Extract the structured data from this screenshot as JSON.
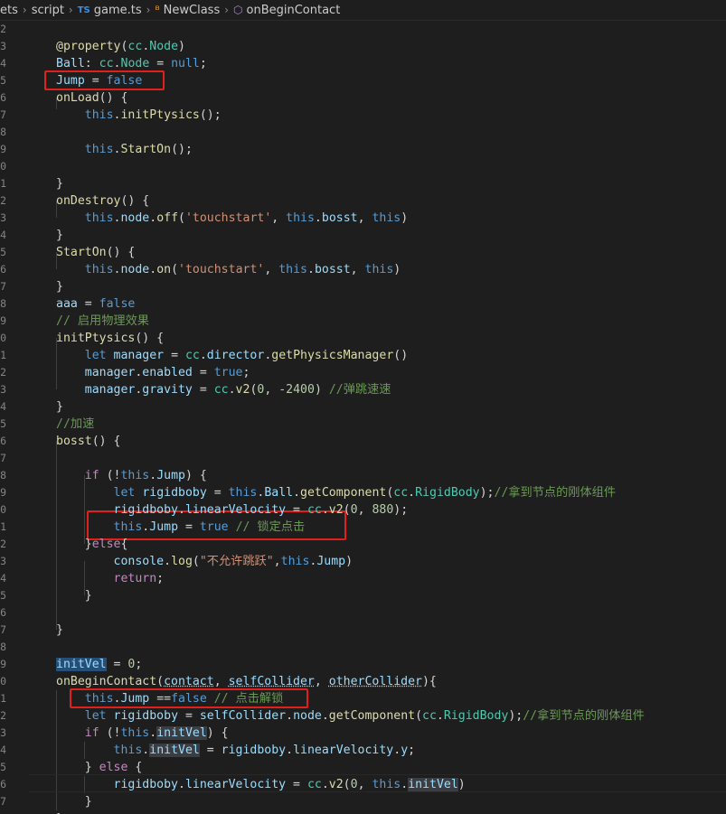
{
  "breadcrumb": {
    "seg0": "ets",
    "seg1": "script",
    "file_badge": "TS",
    "file": "game.ts",
    "class": "NewClass",
    "method": "onBeginContact"
  },
  "line_numbers": [
    "2",
    "3",
    "4",
    "5",
    "6",
    "7",
    "8",
    "9",
    "0",
    "1",
    "2",
    "3",
    "4",
    "5",
    "6",
    "7",
    "8",
    "9",
    "0",
    "1",
    "2",
    "3",
    "4",
    "5",
    "6",
    "7",
    "8",
    "9",
    "0",
    "1",
    "2",
    "3",
    "4",
    "5",
    "6",
    "7",
    "8",
    "9",
    "0",
    "1",
    "2",
    "3",
    "4",
    "5",
    "6",
    "7",
    "8"
  ],
  "code_lines": [
    [],
    [
      [
        "fn",
        "@property"
      ],
      [
        "d",
        "("
      ],
      [
        "cls",
        "cc"
      ],
      [
        "d",
        "."
      ],
      [
        "cls",
        "Node"
      ],
      [
        "d",
        ")"
      ]
    ],
    [
      [
        "prop",
        "Ball"
      ],
      [
        "d",
        ": "
      ],
      [
        "cls",
        "cc"
      ],
      [
        "d",
        "."
      ],
      [
        "cls",
        "Node"
      ],
      [
        "d",
        " = "
      ],
      [
        "kw",
        "null"
      ],
      [
        "d",
        ";"
      ]
    ],
    [
      [
        "prop",
        "Jump"
      ],
      [
        "d",
        " = "
      ],
      [
        "kw",
        "false"
      ]
    ],
    [
      [
        "fn",
        "onLoad"
      ],
      [
        "d",
        "() {"
      ]
    ],
    [
      [
        "d",
        "    "
      ],
      [
        "kw",
        "this"
      ],
      [
        "d",
        "."
      ],
      [
        "fn",
        "initPtysics"
      ],
      [
        "d",
        "();"
      ]
    ],
    [],
    [
      [
        "d",
        "    "
      ],
      [
        "kw",
        "this"
      ],
      [
        "d",
        "."
      ],
      [
        "fn",
        "StartOn"
      ],
      [
        "d",
        "();"
      ]
    ],
    [],
    [
      [
        "d",
        "}"
      ]
    ],
    [
      [
        "fn",
        "onDestroy"
      ],
      [
        "d",
        "() {"
      ]
    ],
    [
      [
        "d",
        "    "
      ],
      [
        "kw",
        "this"
      ],
      [
        "d",
        "."
      ],
      [
        "prop",
        "node"
      ],
      [
        "d",
        "."
      ],
      [
        "fn",
        "off"
      ],
      [
        "d",
        "("
      ],
      [
        "str",
        "'touchstart'"
      ],
      [
        "d",
        ", "
      ],
      [
        "kw",
        "this"
      ],
      [
        "d",
        "."
      ],
      [
        "prop",
        "bosst"
      ],
      [
        "d",
        ", "
      ],
      [
        "kw",
        "this"
      ],
      [
        "d",
        ")"
      ]
    ],
    [
      [
        "d",
        "}"
      ]
    ],
    [
      [
        "fn",
        "StartOn"
      ],
      [
        "d",
        "() {"
      ]
    ],
    [
      [
        "d",
        "    "
      ],
      [
        "kw",
        "this"
      ],
      [
        "d",
        "."
      ],
      [
        "prop",
        "node"
      ],
      [
        "d",
        "."
      ],
      [
        "fn",
        "on"
      ],
      [
        "d",
        "("
      ],
      [
        "str",
        "'touchstart'"
      ],
      [
        "d",
        ", "
      ],
      [
        "kw",
        "this"
      ],
      [
        "d",
        "."
      ],
      [
        "prop",
        "bosst"
      ],
      [
        "d",
        ", "
      ],
      [
        "kw",
        "this"
      ],
      [
        "d",
        ")"
      ]
    ],
    [
      [
        "d",
        "}"
      ]
    ],
    [
      [
        "prop",
        "aaa"
      ],
      [
        "d",
        " = "
      ],
      [
        "kw",
        "false"
      ]
    ],
    [
      [
        "cmt",
        "// 启用物理效果"
      ]
    ],
    [
      [
        "fn",
        "initPtysics"
      ],
      [
        "d",
        "() {"
      ]
    ],
    [
      [
        "d",
        "    "
      ],
      [
        "kw",
        "let"
      ],
      [
        "d",
        " "
      ],
      [
        "prop",
        "manager"
      ],
      [
        "d",
        " = "
      ],
      [
        "cls",
        "cc"
      ],
      [
        "d",
        "."
      ],
      [
        "prop",
        "director"
      ],
      [
        "d",
        "."
      ],
      [
        "fn",
        "getPhysicsManager"
      ],
      [
        "d",
        "()"
      ]
    ],
    [
      [
        "d",
        "    "
      ],
      [
        "prop",
        "manager"
      ],
      [
        "d",
        "."
      ],
      [
        "prop",
        "enabled"
      ],
      [
        "d",
        " = "
      ],
      [
        "kw",
        "true"
      ],
      [
        "d",
        ";"
      ]
    ],
    [
      [
        "d",
        "    "
      ],
      [
        "prop",
        "manager"
      ],
      [
        "d",
        "."
      ],
      [
        "prop",
        "gravity"
      ],
      [
        "d",
        " = "
      ],
      [
        "cls",
        "cc"
      ],
      [
        "d",
        "."
      ],
      [
        "fn",
        "v2"
      ],
      [
        "d",
        "("
      ],
      [
        "num",
        "0"
      ],
      [
        "d",
        ", "
      ],
      [
        "num",
        "-2400"
      ],
      [
        "d",
        ") "
      ],
      [
        "cmt",
        "//弹跳速速"
      ]
    ],
    [
      [
        "d",
        "}"
      ]
    ],
    [
      [
        "cmt",
        "//加速"
      ]
    ],
    [
      [
        "fn",
        "bosst"
      ],
      [
        "d",
        "() {"
      ]
    ],
    [],
    [
      [
        "d",
        "    "
      ],
      [
        "ctl",
        "if"
      ],
      [
        "d",
        " (!"
      ],
      [
        "kw",
        "this"
      ],
      [
        "d",
        "."
      ],
      [
        "prop",
        "Jump"
      ],
      [
        "d",
        ") {"
      ]
    ],
    [
      [
        "d",
        "        "
      ],
      [
        "kw",
        "let"
      ],
      [
        "d",
        " "
      ],
      [
        "prop",
        "rigidboby"
      ],
      [
        "d",
        " = "
      ],
      [
        "kw",
        "this"
      ],
      [
        "d",
        "."
      ],
      [
        "prop",
        "Ball"
      ],
      [
        "d",
        "."
      ],
      [
        "fn",
        "getComponent"
      ],
      [
        "d",
        "("
      ],
      [
        "cls",
        "cc"
      ],
      [
        "d",
        "."
      ],
      [
        "cls",
        "RigidBody"
      ],
      [
        "d",
        ");"
      ],
      [
        "cmt",
        "//拿到节点的刚体组件"
      ]
    ],
    [
      [
        "d",
        "        "
      ],
      [
        "prop",
        "rigidboby"
      ],
      [
        "d",
        "."
      ],
      [
        "prop",
        "linearVelocity"
      ],
      [
        "d",
        " = "
      ],
      [
        "cls",
        "cc"
      ],
      [
        "d",
        "."
      ],
      [
        "fn",
        "v2"
      ],
      [
        "d",
        "("
      ],
      [
        "num",
        "0"
      ],
      [
        "d",
        ", "
      ],
      [
        "num",
        "880"
      ],
      [
        "d",
        ");"
      ]
    ],
    [
      [
        "d",
        "        "
      ],
      [
        "kw",
        "this"
      ],
      [
        "d",
        "."
      ],
      [
        "prop",
        "Jump"
      ],
      [
        "d",
        " = "
      ],
      [
        "kw",
        "true"
      ],
      [
        "d",
        " "
      ],
      [
        "cmt",
        "// 锁定点击"
      ]
    ],
    [
      [
        "d",
        "    }"
      ],
      [
        "ctl",
        "else"
      ],
      [
        "d",
        "{"
      ]
    ],
    [
      [
        "d",
        "        "
      ],
      [
        "prop",
        "console"
      ],
      [
        "d",
        "."
      ],
      [
        "fn",
        "log"
      ],
      [
        "d",
        "("
      ],
      [
        "str",
        "\"不允许跳跃\""
      ],
      [
        "d",
        ","
      ],
      [
        "kw",
        "this"
      ],
      [
        "d",
        "."
      ],
      [
        "prop",
        "Jump"
      ],
      [
        "d",
        ")"
      ]
    ],
    [
      [
        "d",
        "        "
      ],
      [
        "ctl",
        "return"
      ],
      [
        "d",
        ";"
      ]
    ],
    [
      [
        "d",
        "    }"
      ]
    ],
    [],
    [
      [
        "d",
        "}"
      ]
    ],
    [],
    [
      [
        "prop hl",
        "initVel"
      ],
      [
        "d",
        " = "
      ],
      [
        "num",
        "0"
      ],
      [
        "d",
        ";"
      ]
    ],
    [
      [
        "fn",
        "onBeginContact"
      ],
      [
        "d",
        "("
      ],
      [
        "prop ul",
        "contact"
      ],
      [
        "d",
        ", "
      ],
      [
        "prop ul",
        "selfCollider"
      ],
      [
        "d",
        ", "
      ],
      [
        "prop ul",
        "otherCollider"
      ],
      [
        "d",
        "){"
      ]
    ],
    [
      [
        "d",
        "    "
      ],
      [
        "kw",
        "this"
      ],
      [
        "d",
        "."
      ],
      [
        "prop",
        "Jump"
      ],
      [
        "d",
        " =="
      ],
      [
        "kw",
        "false"
      ],
      [
        "d",
        " "
      ],
      [
        "cmt",
        "// 点击解锁"
      ]
    ],
    [
      [
        "d",
        "    "
      ],
      [
        "kw",
        "let"
      ],
      [
        "d",
        " "
      ],
      [
        "prop",
        "rigidboby"
      ],
      [
        "d",
        " = "
      ],
      [
        "prop",
        "selfCollider"
      ],
      [
        "d",
        "."
      ],
      [
        "prop",
        "node"
      ],
      [
        "d",
        "."
      ],
      [
        "fn",
        "getComponent"
      ],
      [
        "d",
        "("
      ],
      [
        "cls",
        "cc"
      ],
      [
        "d",
        "."
      ],
      [
        "cls",
        "RigidBody"
      ],
      [
        "d",
        ");"
      ],
      [
        "cmt",
        "//拿到节点的刚体组件"
      ]
    ],
    [
      [
        "d",
        "    "
      ],
      [
        "ctl",
        "if"
      ],
      [
        "d",
        " (!"
      ],
      [
        "kw",
        "this"
      ],
      [
        "d",
        "."
      ],
      [
        "prop hl2",
        "initVel"
      ],
      [
        "d",
        ") {"
      ]
    ],
    [
      [
        "d",
        "        "
      ],
      [
        "kw",
        "this"
      ],
      [
        "d",
        "."
      ],
      [
        "prop hl2",
        "initVel"
      ],
      [
        "d",
        " = "
      ],
      [
        "prop",
        "rigidboby"
      ],
      [
        "d",
        "."
      ],
      [
        "prop",
        "linearVelocity"
      ],
      [
        "d",
        "."
      ],
      [
        "prop",
        "y"
      ],
      [
        "d",
        ";"
      ]
    ],
    [
      [
        "d",
        "    } "
      ],
      [
        "ctl",
        "else"
      ],
      [
        "d",
        " {"
      ]
    ],
    [
      [
        "d",
        "        "
      ],
      [
        "prop",
        "rigidboby"
      ],
      [
        "d",
        "."
      ],
      [
        "prop",
        "linearVelocity"
      ],
      [
        "d",
        " = "
      ],
      [
        "cls",
        "cc"
      ],
      [
        "d",
        "."
      ],
      [
        "fn",
        "v2"
      ],
      [
        "d",
        "("
      ],
      [
        "num",
        "0"
      ],
      [
        "d",
        ", "
      ],
      [
        "kw",
        "this"
      ],
      [
        "d",
        "."
      ],
      [
        "prop hl2",
        "initVel"
      ],
      [
        "d",
        ")"
      ]
    ],
    [
      [
        "d",
        "    }"
      ]
    ],
    [
      [
        "d",
        "}"
      ]
    ]
  ]
}
